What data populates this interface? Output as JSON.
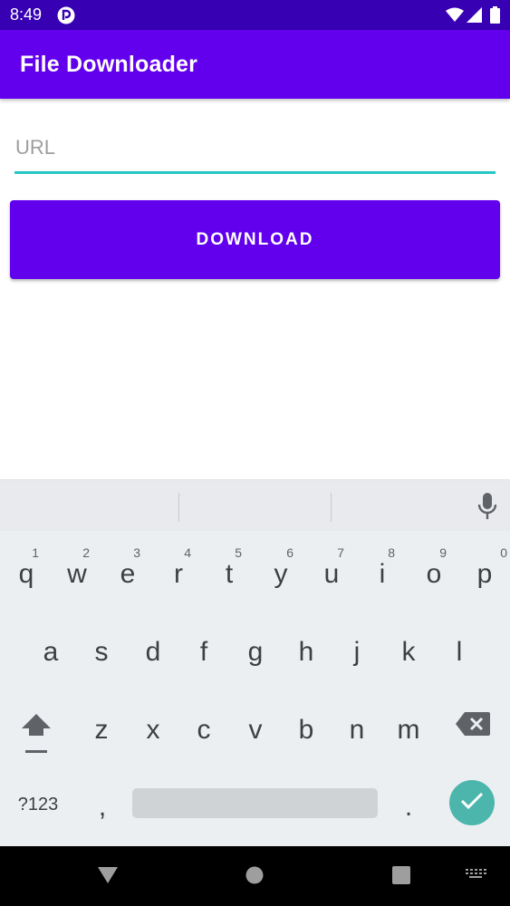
{
  "status_bar": {
    "time": "8:49"
  },
  "app_bar": {
    "title": "File Downloader"
  },
  "url_field": {
    "placeholder": "URL",
    "value": ""
  },
  "download_button": {
    "label": "DOWNLOAD"
  },
  "keyboard": {
    "row1": [
      {
        "key": "q",
        "hint": "1"
      },
      {
        "key": "w",
        "hint": "2"
      },
      {
        "key": "e",
        "hint": "3"
      },
      {
        "key": "r",
        "hint": "4"
      },
      {
        "key": "t",
        "hint": "5"
      },
      {
        "key": "y",
        "hint": "6"
      },
      {
        "key": "u",
        "hint": "7"
      },
      {
        "key": "i",
        "hint": "8"
      },
      {
        "key": "o",
        "hint": "9"
      },
      {
        "key": "p",
        "hint": "0"
      }
    ],
    "row2": [
      "a",
      "s",
      "d",
      "f",
      "g",
      "h",
      "j",
      "k",
      "l"
    ],
    "row3": [
      "z",
      "x",
      "c",
      "v",
      "b",
      "n",
      "m"
    ],
    "symbols_label": "?123",
    "comma": ",",
    "period": "."
  },
  "colors": {
    "status_bar": "#3700b3",
    "primary": "#6200ee",
    "accent": "#26c6c6",
    "enter_key": "#4db6ac"
  },
  "icons": {
    "status": [
      "notification-icon",
      "wifi-icon",
      "signal-icon",
      "battery-icon"
    ],
    "navigation": [
      "back-icon",
      "home-icon",
      "recents-icon",
      "keyboard-switch-icon"
    ],
    "keyboard": [
      "mic-icon",
      "shift-icon",
      "backspace-icon",
      "checkmark-icon"
    ]
  }
}
